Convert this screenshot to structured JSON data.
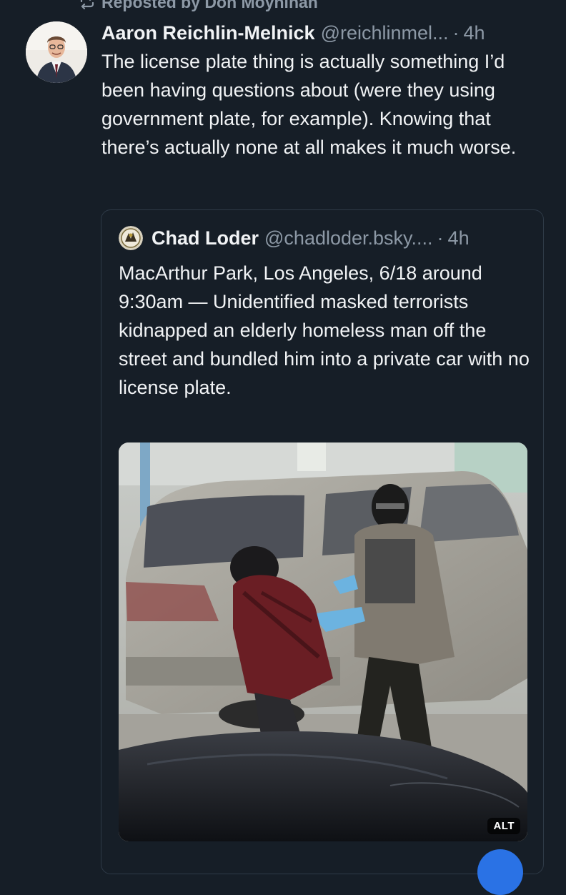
{
  "repost": {
    "label": "Reposted by Don Moynihan",
    "icon": "repost-icon"
  },
  "post": {
    "display_name": "Aaron Reichlin-Melnick",
    "handle": "@reichlinmel...",
    "separator": "·",
    "time": "4h",
    "text": "The license plate thing is actually something I’d been having questions about (were they using government plate, for example). Knowing that there’s actually none at all makes it much worse."
  },
  "quote": {
    "display_name": "Chad Loder",
    "handle": "@chadloder.bsky....",
    "separator": "·",
    "time": "4h",
    "text": "MacArthur Park, Los Angeles, 6/18 around 9:30am — Unidentified masked terrorists kidnapped an elderly homeless man off the street and bundled him into a private car with no license plate.",
    "media": {
      "alt_label": "ALT"
    }
  },
  "colors": {
    "background": "#161e27",
    "text_primary": "#f1f3f5",
    "text_secondary": "#8d99a6",
    "card_border": "#2e3a47",
    "accent": "#2a72e5"
  }
}
